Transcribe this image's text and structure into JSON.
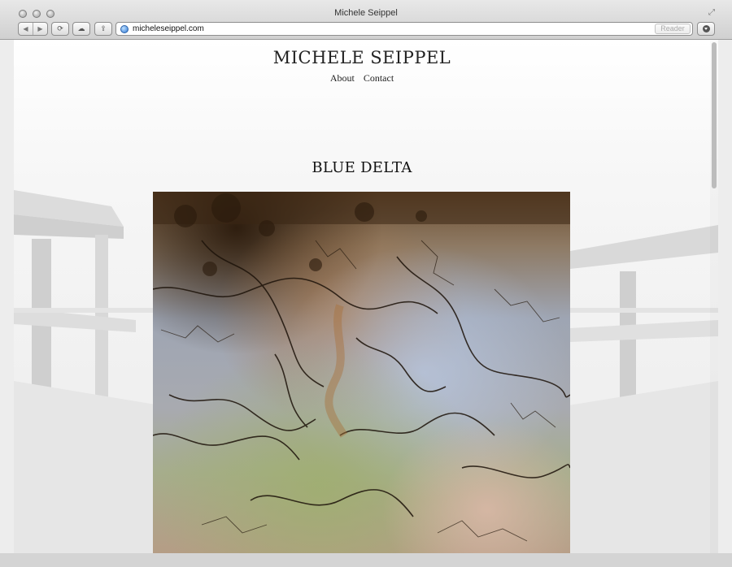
{
  "window": {
    "title": "Michele Seippel"
  },
  "toolbar": {
    "url": "micheleseippel.com",
    "reader_label": "Reader",
    "icons": [
      "back-icon",
      "forward-icon",
      "sync-icon",
      "cloud-icon",
      "share-icon",
      "globe-icon",
      "download-icon"
    ]
  },
  "site": {
    "title": "MICHELE SEIPPEL",
    "nav": [
      "About",
      "Contact"
    ]
  },
  "content": {
    "work_title": "BLUE DELTA"
  }
}
